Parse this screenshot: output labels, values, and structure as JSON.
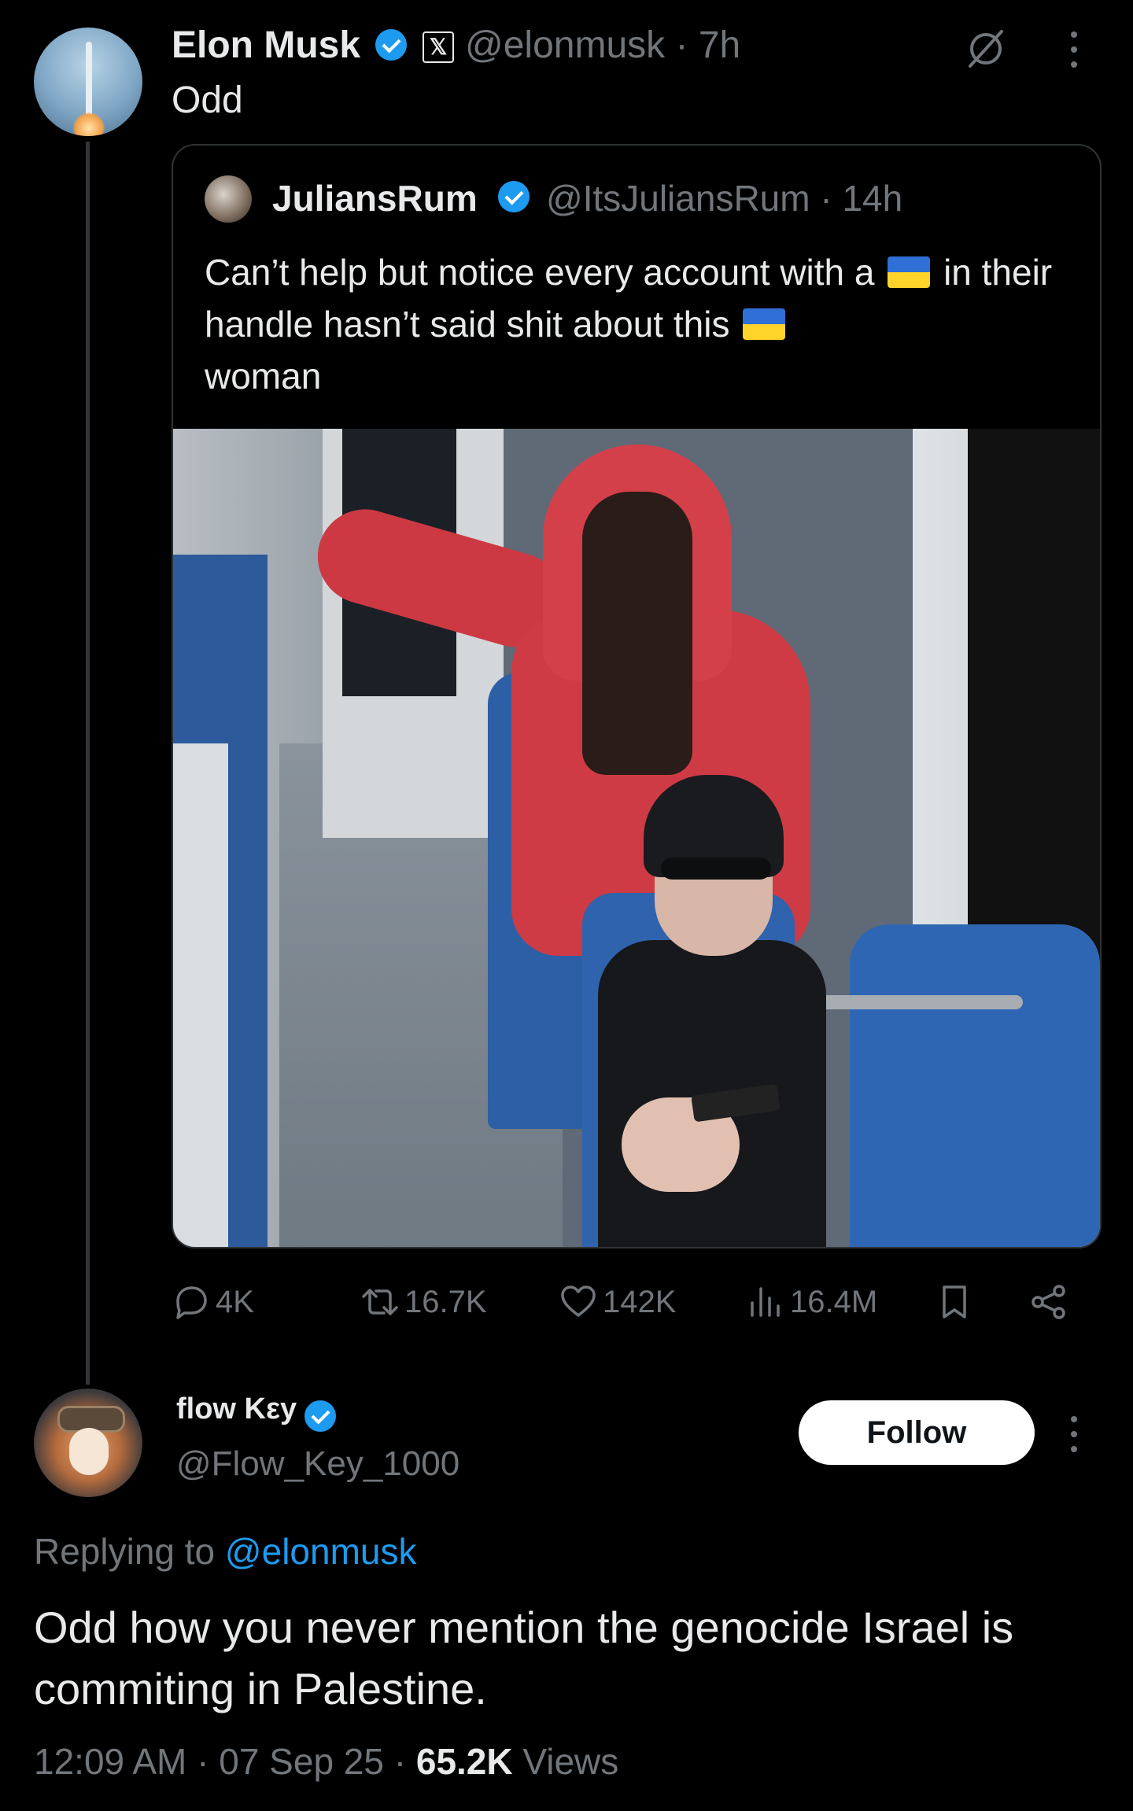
{
  "main_tweet": {
    "author_name": "Elon Musk",
    "handle_time": "@elonmusk · 7h",
    "text": "Odd",
    "icons": {
      "verified": "verified-badge-icon",
      "x_logo": "x-logo-icon",
      "grok": "grok-icon",
      "more": "more-options-icon"
    }
  },
  "quoted_tweet": {
    "author_name": "JuliansRum",
    "handle_time": "@ItsJuliansRum · 14h",
    "text_part1": "Can’t help but notice every account with a",
    "text_part2": "in their handle hasn’t said shit about this",
    "text_part3": "woman",
    "flag_colors": {
      "top": "#2f6fd6",
      "bottom": "#ffd42a"
    }
  },
  "actions": {
    "replies": "4K",
    "reposts": "16.7K",
    "likes": "142K",
    "views": "16.4M"
  },
  "reply": {
    "author_name": "flow Kεy",
    "handle": "@Flow_Key_1000",
    "follow_label": "Follow",
    "replying_prefix": "Replying to ",
    "replying_mention": "@elonmusk",
    "text": "Odd how you never mention the genocide Israel is commiting in Palestine.",
    "meta_prefix": "12:09 AM · 07 Sep 25 · ",
    "views_count": "65.2K",
    "views_label": " Views"
  },
  "colors": {
    "accent": "#1d9bf0",
    "background": "#000000",
    "text": "#e7e9ea",
    "muted": "#71767b"
  }
}
